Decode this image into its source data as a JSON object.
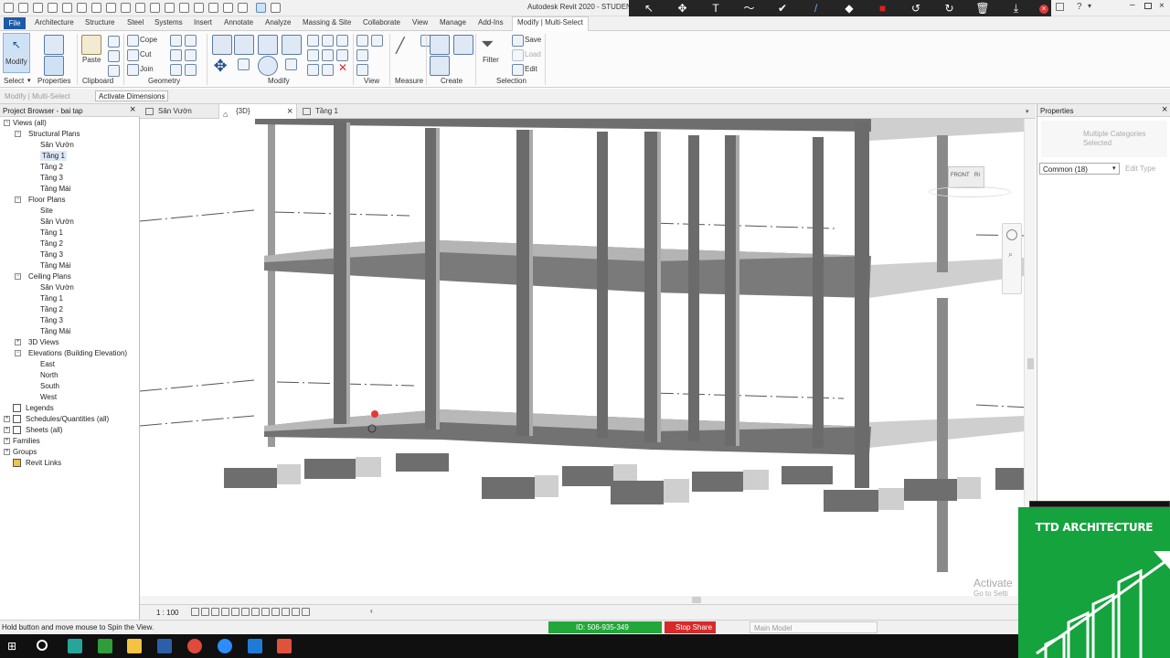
{
  "window": {
    "title": "Autodesk Revit 2020 - STUDEN"
  },
  "share_toolbar": {
    "buttons": [
      {
        "label": "Mouse",
        "glyph": "↖"
      },
      {
        "label": "Select",
        "glyph": "✥"
      },
      {
        "label": "Text",
        "glyph": "T"
      },
      {
        "label": "Draw",
        "glyph": "〜"
      },
      {
        "label": "Stamp",
        "glyph": "✔"
      },
      {
        "label": "Spotlight",
        "glyph": "/"
      },
      {
        "label": "Eraser",
        "glyph": "◆"
      },
      {
        "label": "Format",
        "glyph": "■"
      },
      {
        "label": "Undo",
        "glyph": "↺"
      },
      {
        "label": "Redo",
        "glyph": "↻"
      },
      {
        "label": "Clear",
        "glyph": "🗑"
      },
      {
        "label": "Save",
        "glyph": "⤓"
      }
    ],
    "active": "Spotlight",
    "active_color": "#6da8ff",
    "format_color": "#e02020"
  },
  "ribbon_tabs": [
    "File",
    "Architecture",
    "Structure",
    "Steel",
    "Systems",
    "Insert",
    "Annotate",
    "Analyze",
    "Massing & Site",
    "Collaborate",
    "View",
    "Manage",
    "Add-Ins",
    "Modify | Multi-Select"
  ],
  "ribbon": {
    "modify_label": "Modify",
    "paste_label": "Paste",
    "cope_label": "Cope",
    "cut_label": "Cut",
    "join_label": "Join",
    "filter_label": "Filter",
    "save_label": "Save",
    "load_label": "Load",
    "edit_label": "Edit",
    "panels": [
      "Select",
      "Properties",
      "Clipboard",
      "Geometry",
      "Modify",
      "View",
      "Measure",
      "Create",
      "Selection"
    ]
  },
  "options_bar": {
    "context": "Modify | Multi-Select",
    "activate_dimensions": "Activate Dimensions"
  },
  "project_browser": {
    "title": "Project Browser - bai tap",
    "items": [
      {
        "label": "Views (all)",
        "level": 0,
        "toggle": "−"
      },
      {
        "label": "Structural Plans",
        "level": 1,
        "toggle": "−"
      },
      {
        "label": "Sân Vườn",
        "level": 2
      },
      {
        "label": "Tầng 1",
        "level": 2,
        "selected": true
      },
      {
        "label": "Tầng 2",
        "level": 2
      },
      {
        "label": "Tầng 3",
        "level": 2
      },
      {
        "label": "Tầng Mái",
        "level": 2
      },
      {
        "label": "Floor Plans",
        "level": 1,
        "toggle": "−"
      },
      {
        "label": "Site",
        "level": 2
      },
      {
        "label": "Sân Vườn",
        "level": 2
      },
      {
        "label": "Tầng 1",
        "level": 2
      },
      {
        "label": "Tầng 2",
        "level": 2
      },
      {
        "label": "Tầng 3",
        "level": 2
      },
      {
        "label": "Tầng Mái",
        "level": 2
      },
      {
        "label": "Ceiling Plans",
        "level": 1,
        "toggle": "−"
      },
      {
        "label": "Sân Vườn",
        "level": 2
      },
      {
        "label": "Tầng 1",
        "level": 2
      },
      {
        "label": "Tầng 2",
        "level": 2
      },
      {
        "label": "Tầng 3",
        "level": 2
      },
      {
        "label": "Tầng Mái",
        "level": 2
      },
      {
        "label": "3D Views",
        "level": 1,
        "toggle": "+"
      },
      {
        "label": "Elevations (Building Elevation)",
        "level": 1,
        "toggle": "−"
      },
      {
        "label": "East",
        "level": 2
      },
      {
        "label": "North",
        "level": 2
      },
      {
        "label": "South",
        "level": 2
      },
      {
        "label": "West",
        "level": 2
      },
      {
        "label": "Legends",
        "level": 0,
        "icon": true
      },
      {
        "label": "Schedules/Quantities (all)",
        "level": 0,
        "toggle": "+",
        "icon": true
      },
      {
        "label": "Sheets (all)",
        "level": 0,
        "toggle": "+",
        "icon": true
      },
      {
        "label": "Families",
        "level": 0,
        "toggle": "+"
      },
      {
        "label": "Groups",
        "level": 0,
        "toggle": "+"
      },
      {
        "label": "Revit Links",
        "level": 0,
        "icon": true
      }
    ]
  },
  "view_tabs": [
    {
      "label": "Sân Vườn",
      "active": false
    },
    {
      "label": "{3D}",
      "active": true
    },
    {
      "label": "Tầng 1",
      "active": false
    }
  ],
  "viewcube": {
    "front": "FRONT",
    "right": "RI"
  },
  "view_control": {
    "scale": "1 : 100"
  },
  "properties": {
    "title": "Properties",
    "type": "Multiple Categories Selected",
    "filter": "Common (18)",
    "edit_type": "Edit Type"
  },
  "status": {
    "hint": "Hold button and move mouse to Spin the View.",
    "meeting_id": "ID: 506-935-349",
    "stop_share": "Stop Share",
    "model": "Main Model"
  },
  "watermark": {
    "activate": "Activate",
    "go_to": "Go to Setti"
  },
  "logo": {
    "text": "TTD ARCHITECTURE",
    "color": "#14a33c"
  },
  "colors": {
    "accent": "#1d5aa8",
    "concrete_dark": "#6b6b6b",
    "concrete_mid": "#8c8c8c",
    "concrete_light": "#c9c9c9",
    "stop_share": "#d82a2a",
    "meeting_green": "#23a63a"
  }
}
